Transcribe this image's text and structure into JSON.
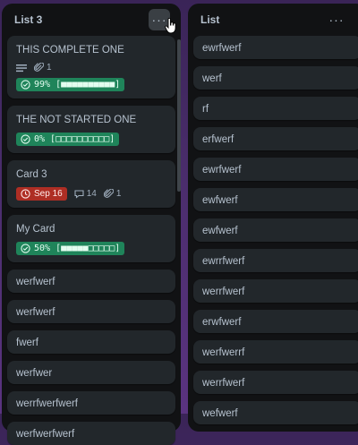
{
  "list_a": {
    "title": "List 3",
    "menu": "···",
    "cards": {
      "c1": {
        "title": "THIS COMPLETE ONE",
        "attachments": "1",
        "progress": "99% [■■■■■■■■■■]"
      },
      "c2": {
        "title": "THE NOT STARTED ONE",
        "progress": "0% [□□□□□□□□□□]"
      },
      "c3": {
        "title": "Card 3",
        "due": "Sep 16",
        "comments": "14",
        "attachments": "1"
      },
      "c4": {
        "title": "My Card",
        "progress": "50% [■■■■■□□□□□]"
      },
      "simple": [
        "werfwerf",
        "werfwerf",
        "fwerf",
        "werfwer",
        "werrfwerfwerf",
        "werfwerfwerf"
      ]
    }
  },
  "list_b": {
    "title": "List",
    "menu": "···",
    "cards": [
      "ewrfwerf",
      "werf",
      "rf",
      "erfwerf",
      "ewrfwerf",
      "ewfwerf",
      "ewfwerf",
      "ewrrfwerf",
      "werrfwerf",
      "erwfwerf",
      "werfwerrf",
      "werrfwerf",
      "wefwerf"
    ]
  },
  "colors": {
    "badge_green": "#1f845a",
    "badge_red": "#ae2e24",
    "card_bg": "#22272b",
    "list_bg": "#111214"
  }
}
